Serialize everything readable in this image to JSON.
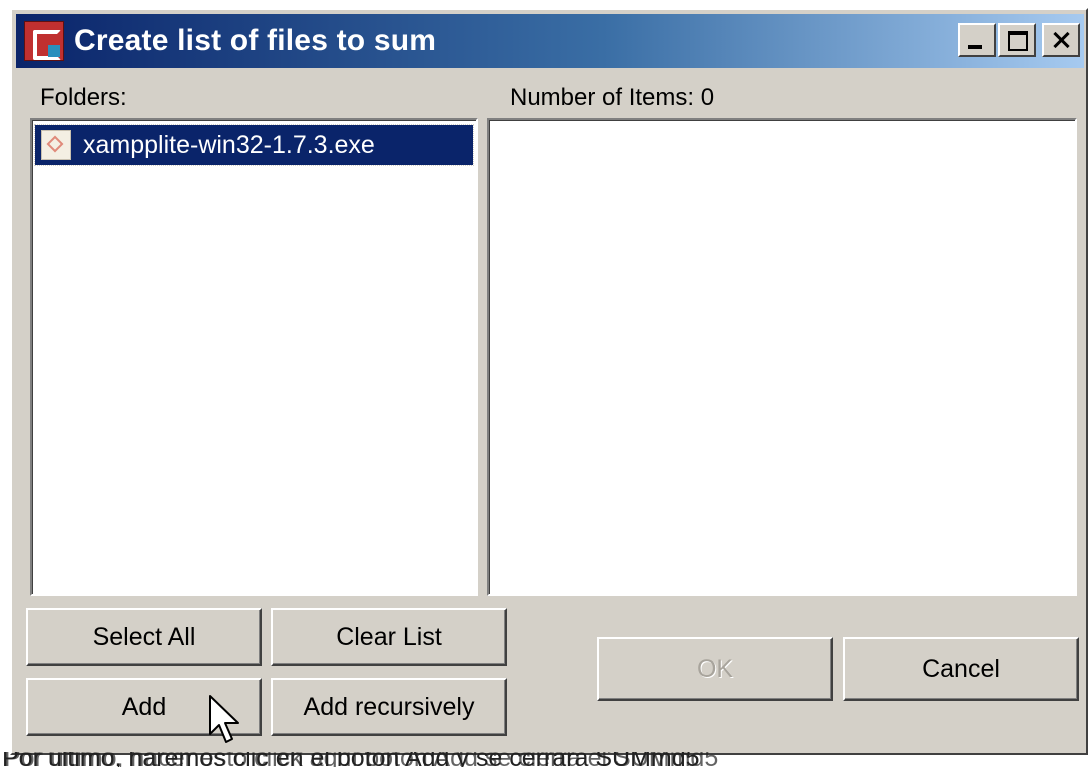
{
  "window": {
    "title": "Create list of files to sum",
    "controls": {
      "minimize_icon": "minimize-icon",
      "maximize_icon": "maximize-icon",
      "close_icon": "close-icon"
    }
  },
  "folders": {
    "label": "Folders:",
    "items": [
      {
        "name": "xampplite-win32-1.7.3.exe",
        "selected": true,
        "icon": "executable-file-icon"
      }
    ]
  },
  "items_panel": {
    "label": "Number of Items: 0",
    "count": 0
  },
  "buttons": {
    "select_all": "Select All",
    "clear_list": "Clear List",
    "add": "Add",
    "add_recursively": "Add recursively",
    "ok": "OK",
    "cancel": "Cancel"
  },
  "colors": {
    "title_gradient_start": "#0a246a",
    "title_gradient_end": "#a6caf0",
    "selection": "#0a246a",
    "dialog_face": "#d4d0c8"
  },
  "caption_overlay": {
    "text_a": "Por último, haremos clic en el botón Add y se cerrará SUMmd5",
    "text_b": "Por último, hacer esto click aquí botón Add se cierra el SUMmd5"
  }
}
